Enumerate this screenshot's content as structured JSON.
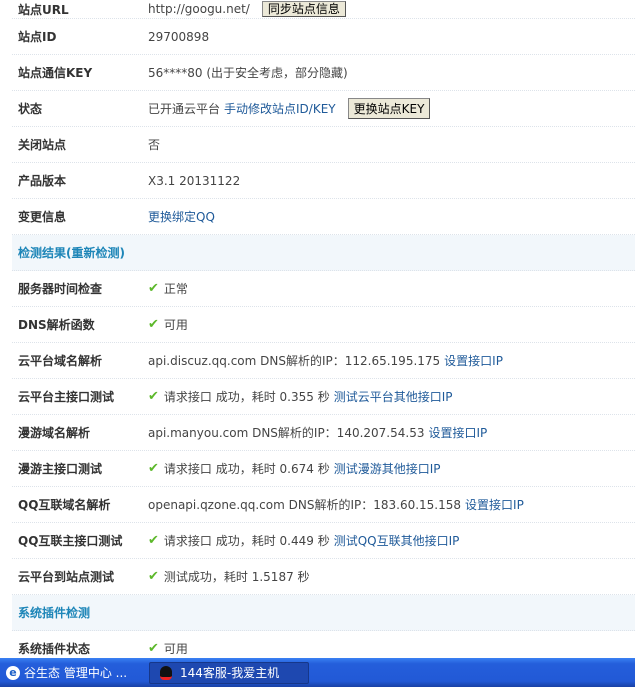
{
  "rows": [
    {
      "label": "站点URL",
      "value": "http://googu.net/",
      "button": "同步站点信息"
    },
    {
      "label": "站点ID",
      "value": "29700898"
    },
    {
      "label": "站点通信KEY",
      "value": "56****80 (出于安全考虑，部分隐藏)"
    },
    {
      "label": "状态",
      "value": "已开通云平台",
      "link": "手动修改站点ID/KEY",
      "button": "更换站点KEY"
    },
    {
      "label": "关闭站点",
      "value": "否"
    },
    {
      "label": "产品版本",
      "value": "X3.1 20131122"
    },
    {
      "label": "变更信息",
      "link": "更换绑定QQ"
    }
  ],
  "section1": "检测结果(重新检测)",
  "checks": [
    {
      "label": "服务器时间检查",
      "value": "正常",
      "ok": true
    },
    {
      "label": "DNS解析函数",
      "value": "可用",
      "ok": true
    },
    {
      "label": "云平台域名解析",
      "value": "api.discuz.qq.com DNS解析的IP：112.65.195.175",
      "link": "设置接口IP"
    },
    {
      "label": "云平台主接口测试",
      "value": "请求接口 成功，耗时 0.355 秒",
      "link": "测试云平台其他接口IP",
      "ok": true
    },
    {
      "label": "漫游域名解析",
      "value": "api.manyou.com DNS解析的IP：140.207.54.53",
      "link": "设置接口IP"
    },
    {
      "label": "漫游主接口测试",
      "value": "请求接口 成功，耗时 0.674 秒",
      "link": "测试漫游其他接口IP",
      "ok": true
    },
    {
      "label": "QQ互联域名解析",
      "value": "openapi.qzone.qq.com DNS解析的IP：183.60.15.158",
      "link": "设置接口IP"
    },
    {
      "label": "QQ互联主接口测试",
      "value": "请求接口 成功，耗时 0.449 秒",
      "link": "测试QQ互联其他接口IP",
      "ok": true
    },
    {
      "label": "云平台到站点测试",
      "value": "测试成功，耗时 1.5187 秒",
      "ok": true
    }
  ],
  "section2": "系统插件检测",
  "plugin": {
    "label": "系统插件状态",
    "value": "可用"
  },
  "taskbar": {
    "item1": "谷生态 管理中心 ...",
    "item2": "144客服-我爱主机"
  }
}
